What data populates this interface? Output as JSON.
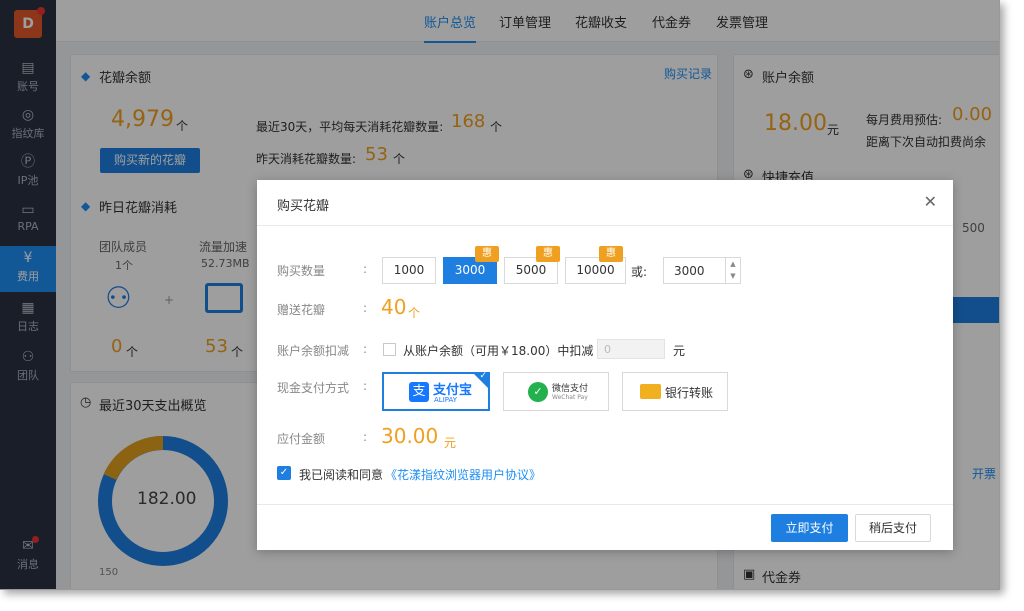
{
  "sidebar": {
    "avatar_letter": "D",
    "items": [
      {
        "label": "账号",
        "icon": "account-card-icon"
      },
      {
        "label": "指纹库",
        "icon": "fingerprint-icon"
      },
      {
        "label": "IP池",
        "icon": "ip-pool-icon"
      },
      {
        "label": "RPA",
        "icon": "rpa-screen-icon"
      },
      {
        "label": "费用",
        "icon": "yen-icon"
      },
      {
        "label": "日志",
        "icon": "log-icon"
      },
      {
        "label": "团队",
        "icon": "team-icon"
      }
    ],
    "message_label": "消息"
  },
  "topnav": {
    "tabs": [
      "账户总览",
      "订单管理",
      "花瓣收支",
      "代金券",
      "发票管理"
    ]
  },
  "petals_card": {
    "title": "花瓣余额",
    "records_link": "购买记录",
    "balance": "4,979",
    "unit": "个",
    "buy_button": "购买新的花瓣",
    "avg_label": "最近30天，平均每天消耗花瓣数量:",
    "avg_value": "168",
    "yesterday_label": "昨天消耗花瓣数量:",
    "yesterday_value": "53"
  },
  "consumption_card": {
    "title": "昨日花瓣消耗",
    "items": [
      {
        "label": "团队成员",
        "sub": "1个",
        "value": "0",
        "unit": "个"
      },
      {
        "label": "流量加速",
        "sub": "52.73MB",
        "value": "53",
        "unit": "个"
      }
    ],
    "plus": "+"
  },
  "overview_card": {
    "title": "最近30天支出概览",
    "donut_value": "182.00",
    "axis_label": "150"
  },
  "account_card": {
    "title": "账户余额",
    "balance": "18.00",
    "unit": "元",
    "monthly_label": "每月费用预估:",
    "monthly_value": "0.00",
    "next_label": "距离下次自动扣费尚余",
    "quick_title": "快捷充值",
    "quick_value": "500",
    "invoice_link": "开票",
    "voucher_title": "代金券"
  },
  "modal": {
    "title": "购买花瓣",
    "qty_label": "购买数量",
    "qty_options": [
      "1000",
      "3000",
      "5000",
      "10000"
    ],
    "qty_selected": "3000",
    "hui_badge": "惠",
    "or_label": "或:",
    "custom_qty": "3000",
    "bonus_label": "赠送花瓣",
    "bonus_value": "40",
    "bonus_unit": "个",
    "deduct_label": "账户余额扣减",
    "deduct_text": "从账户余额（可用￥18.00）中扣减",
    "deduct_input_placeholder": "0",
    "deduct_unit": "元",
    "pay_label": "现金支付方式",
    "pay_methods": [
      {
        "name": "支付宝",
        "sub": "ALIPAY",
        "icon": "alipay-icon"
      },
      {
        "name": "微信支付",
        "sub": "WeChat Pay",
        "icon": "wechat-pay-icon"
      },
      {
        "name": "银行转账",
        "icon": "bank-card-icon"
      }
    ],
    "amount_label": "应付金额",
    "amount_value": "30.00",
    "amount_unit": "元",
    "agree_prefix": "我已阅读和同意",
    "agree_link": "《花漾指纹浏览器用户协议》",
    "pay_now": "立即支付",
    "pay_later": "稍后支付",
    "colon": ":"
  },
  "colors": {
    "accent": "#1e8ef3",
    "orange": "#f0a020",
    "sidebar": "#2b3141"
  }
}
